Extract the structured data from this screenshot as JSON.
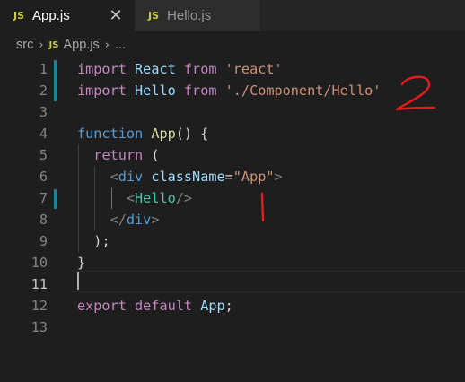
{
  "tabs": [
    {
      "badge": "JS",
      "label": "App.js",
      "active": true
    },
    {
      "badge": "JS",
      "label": "Hello.js",
      "active": false
    }
  ],
  "breadcrumb": {
    "folder": "src",
    "file_badge": "JS",
    "file": "App.js",
    "more": "..."
  },
  "editor": {
    "line_numbers": [
      "1",
      "2",
      "3",
      "4",
      "5",
      "6",
      "7",
      "8",
      "9",
      "10",
      "11",
      "12",
      "13"
    ],
    "current_line": "11",
    "code": {
      "l1": {
        "import": "import",
        "name": "React",
        "from": "from",
        "source": "'react'"
      },
      "l2": {
        "import": "import",
        "name": "Hello",
        "from": "from",
        "source": "'./Component/Hello'"
      },
      "l4": {
        "keyword": "function",
        "name": "App",
        "rest": "() {"
      },
      "l5": {
        "keyword": "return",
        "rest": "("
      },
      "l6": {
        "open": "<",
        "tag": "div",
        "attr": "className",
        "eq": "=",
        "value": "\"App\"",
        "close": ">"
      },
      "l7": {
        "open": "<",
        "tag": "Hello",
        "close": "/>"
      },
      "l8": {
        "open": "</",
        "tag": "div",
        "close": ">"
      },
      "l9": {
        "text": ");"
      },
      "l10": {
        "text": "}"
      },
      "l12": {
        "export": "export",
        "default": "default",
        "name": "App",
        "end": ";"
      }
    }
  },
  "annotations": {
    "color": "#e51c1c",
    "marks": [
      "2",
      "1"
    ]
  },
  "colors": {
    "background": "#1e1e1e",
    "tabbar": "#252526",
    "keyword": "#569cd6",
    "control": "#c586c0",
    "variable": "#9cdcfe",
    "string": "#ce9178",
    "function": "#dcdcaa",
    "component": "#4ec9b0",
    "gutter_modified": "#1b81a8",
    "js_badge": "#cbcb41"
  }
}
